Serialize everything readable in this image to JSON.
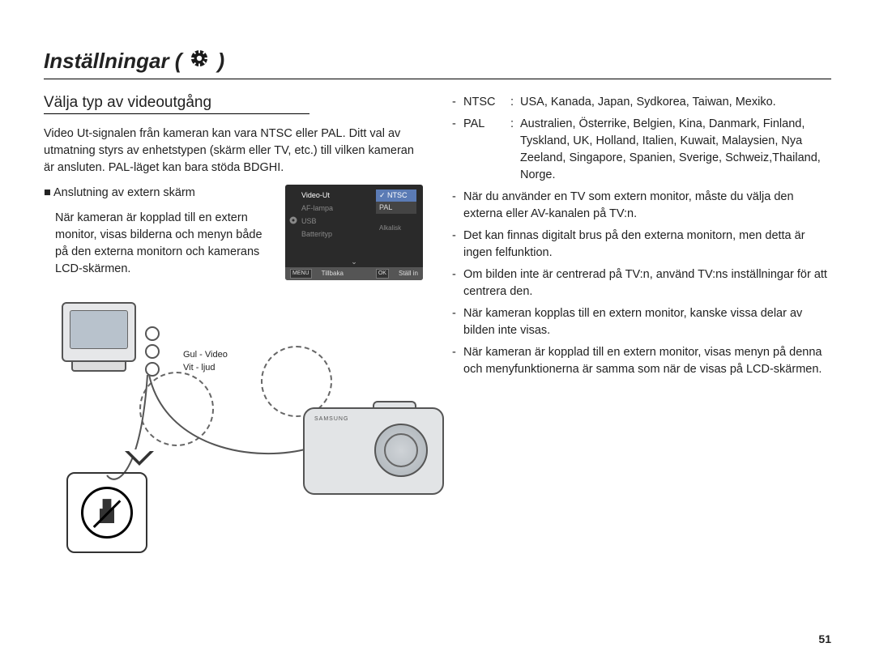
{
  "header": {
    "title_prefix": "Inställningar ( ",
    "title_suffix": " )"
  },
  "left": {
    "subheading": "Välja typ av videoutgång",
    "intro": "Video Ut-signalen från kameran kan vara NTSC eller PAL. Ditt val av utmatning styrs av enhetstypen (skärm eller TV, etc.) till vilken kameran är ansluten. PAL-läget kan bara stöda BDGHI.",
    "ext_heading": "Anslutning av extern skärm",
    "ext_body": "När kameran är kopplad till en extern monitor, visas bilderna och menyn både på den externa monitorn och kamerans LCD-skärmen.",
    "cable_yellow": "Gul - Video",
    "cable_white": "Vit - ljud",
    "camera_brand": "SAMSUNG"
  },
  "menu": {
    "items": [
      "Video-Ut",
      "AF-lampa",
      "USB",
      "Batterityp"
    ],
    "options": [
      "NTSC",
      "PAL"
    ],
    "selected": "NTSC",
    "dim_option": "Alkalisk",
    "footer_left_key": "MENU",
    "footer_left": "Tillbaka",
    "footer_right_key": "OK",
    "footer_right": "Ställ in"
  },
  "right": {
    "rows": [
      {
        "label": "NTSC",
        "content": "USA, Kanada, Japan, Sydkorea, Taiwan, Mexiko."
      },
      {
        "label": "PAL",
        "content": "Australien, Österrike, Belgien, Kina, Danmark, Finland, Tyskland, UK, Holland, Italien, Kuwait, Malaysien, Nya Zeeland, Singapore, Spanien, Sverige, Schweiz,Thailand, Norge."
      }
    ],
    "bullets": [
      "När du använder en TV som extern monitor, måste du välja den externa eller AV-kanalen på TV:n.",
      "Det kan finnas digitalt brus på den externa monitorn, men detta är ingen felfunktion.",
      "Om bilden inte är centrerad på TV:n, använd TV:ns inställningar för att centrera den.",
      "När kameran kopplas till en extern monitor, kanske vissa delar av bilden inte visas.",
      "När kameran är kopplad till en extern monitor, visas menyn på denna och menyfunktionerna är samma som när de visas på LCD-skärmen."
    ]
  },
  "page_number": "51"
}
